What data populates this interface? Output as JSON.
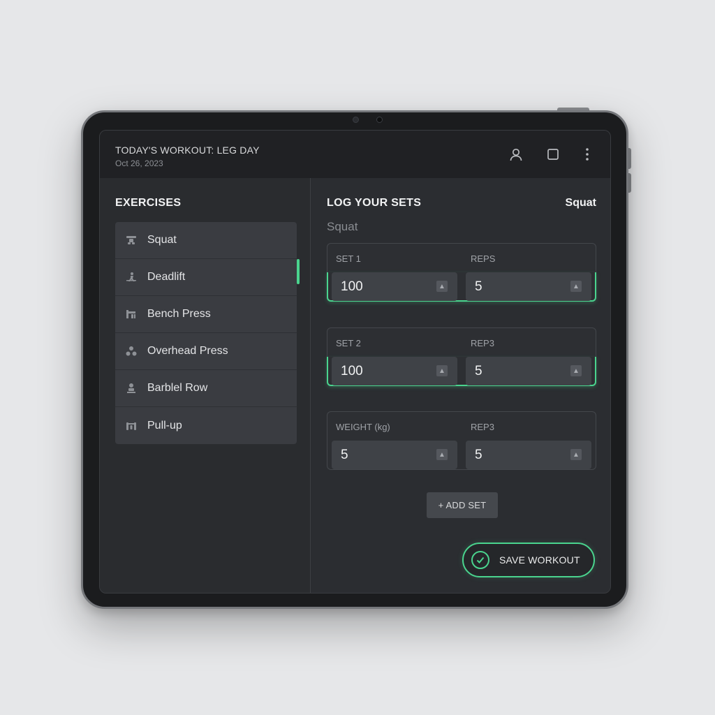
{
  "header": {
    "title": "TODAY'S WORKOUT: LEG DAY",
    "date": "Oct 26, 2023",
    "icons": [
      "user-icon",
      "square-icon",
      "more-vertical-icon"
    ]
  },
  "sidebar": {
    "title": "EXERCISES",
    "items": [
      {
        "label": "Squat",
        "icon": "squat-icon"
      },
      {
        "label": "Deadlift",
        "icon": "deadlift-icon"
      },
      {
        "label": "Bench Press",
        "icon": "bench-press-icon"
      },
      {
        "label": "Overhead Press",
        "icon": "overhead-press-icon"
      },
      {
        "label": "Barblel Row",
        "icon": "barbell-row-icon"
      },
      {
        "label": "Pull-up",
        "icon": "pull-up-icon"
      }
    ]
  },
  "main": {
    "title": "LOG YOUR SETS",
    "current_exercise": "Squat",
    "subtitle": "Squat",
    "sets": [
      {
        "left_label": "SET 1",
        "right_label": "REPS",
        "left_value": "100",
        "right_value": "5"
      },
      {
        "left_label": "SET 2",
        "right_label": "REP3",
        "left_value": "100",
        "right_value": "5"
      },
      {
        "left_label": "WEIGHT (kg)",
        "right_label": "REP3",
        "left_value": "5",
        "right_value": "5"
      }
    ],
    "add_set_label": "+ ADD SET",
    "save_label": "SAVE WORKOUT"
  },
  "colors": {
    "accent": "#4ad48e",
    "background": "#e6e7e9",
    "screen": "#2a2c30"
  }
}
